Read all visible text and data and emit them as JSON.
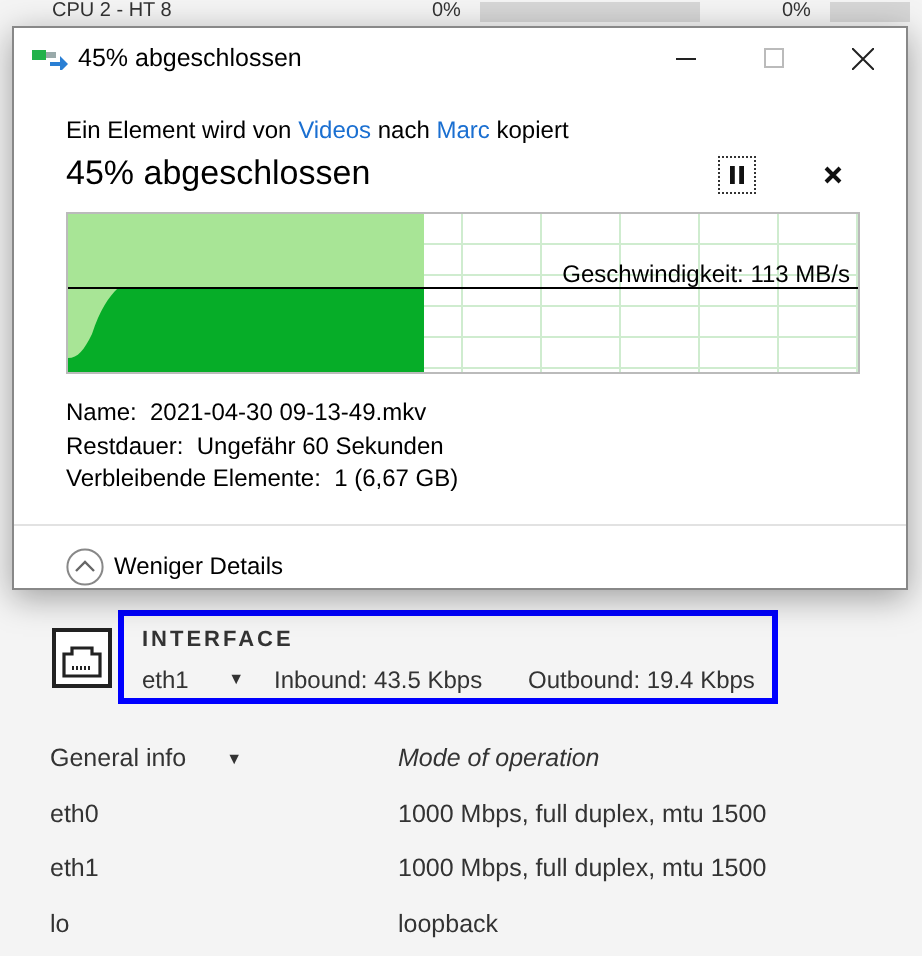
{
  "background": {
    "cpu_row": {
      "label": "CPU 2 - HT 8",
      "value_1": "0%",
      "value_2": "0%"
    },
    "interface": {
      "title": "INTERFACE",
      "selected": "eth1",
      "dropdown_icon": "▼",
      "inbound": "Inbound: 43.5 Kbps",
      "outbound": "Outbound: 19.4 Kbps"
    },
    "table": {
      "columns": [
        "General info",
        "Mode of operation"
      ],
      "dropdown_icon": "▼",
      "rows": [
        [
          "eth0",
          "1000 Mbps, full duplex, mtu 1500"
        ],
        [
          "eth1",
          "1000 Mbps, full duplex, mtu 1500"
        ],
        [
          "lo",
          "loopback"
        ]
      ]
    }
  },
  "dialog": {
    "title": "45% abgeschlossen",
    "message": {
      "prefix": "Ein Element wird von",
      "source": "Videos",
      "middle": "nach",
      "destination": "Marc",
      "suffix": "kopiert"
    },
    "heading": "45% abgeschlossen",
    "level": 0.45,
    "speed": "Geschwindigkeit: 113 MB/s",
    "details": [
      {
        "label": "Name:",
        "value": "2021-04-30 09-13-49.mkv"
      },
      {
        "label": "Restdauer:",
        "value": "Ungefähr 60 Sekunden"
      },
      {
        "label": "Verbleibende Elemente:",
        "value": "1 (6,67 GB)"
      }
    ],
    "toggle": "Weniger Details"
  }
}
